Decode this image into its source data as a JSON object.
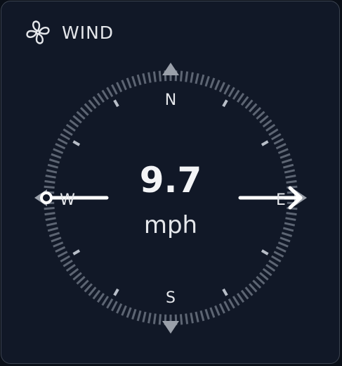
{
  "widget": {
    "title": "WIND",
    "icon": "fan-icon"
  },
  "wind": {
    "speed": "9.7",
    "unit": "mph",
    "direction_degrees": 270
  },
  "compass": {
    "north": "N",
    "south": "S",
    "east": "E",
    "west": "W"
  },
  "colors": {
    "background": "#111827",
    "border": "#3b4350",
    "text": "#e5e7eb",
    "arrow": "#ffffff",
    "ticks": "#5d6573",
    "major_ticks": "#b8bec8"
  }
}
